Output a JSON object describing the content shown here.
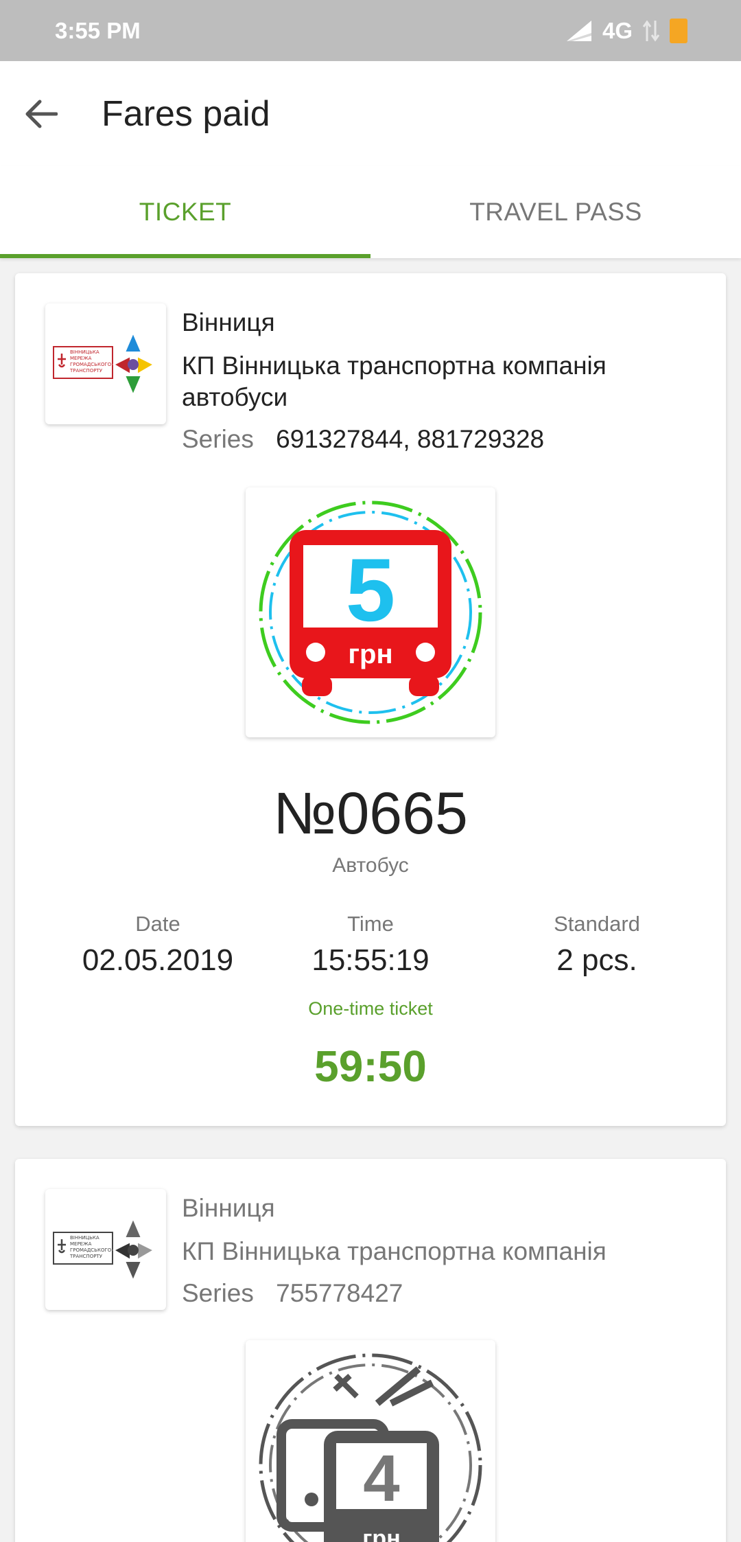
{
  "status_bar": {
    "time": "3:55 PM",
    "network": "4G"
  },
  "header": {
    "title": "Fares paid"
  },
  "tabs": [
    {
      "label": "TICKET",
      "active": true
    },
    {
      "label": "TRAVEL PASS",
      "active": false
    }
  ],
  "tickets": [
    {
      "city": "Вінниця",
      "company": "КП Вінницька транспортна компанія автобуси",
      "series_label": "Series",
      "series": "691327844, 881729328",
      "logo_text": [
        "ВІННИЦЬКА",
        "МЕРЕЖА",
        "ГРОМАДСЬКОГО",
        "ТРАНСПОРТУ"
      ],
      "fare_value": "5",
      "fare_currency": "грн",
      "number": "№0665",
      "transport": "Автобус",
      "date_label": "Date",
      "date": "02.05.2019",
      "time_label": "Time",
      "time": "15:55:19",
      "standard_label": "Standard",
      "standard": "2 pcs.",
      "type": "One-time ticket",
      "countdown": "59:50"
    },
    {
      "city": "Вінниця",
      "company": "КП Вінницька транспортна компанія",
      "series_label": "Series",
      "series": "755778427",
      "logo_text": [
        "ВІННИЦЬКА",
        "МЕРЕЖА",
        "ГРОМАДСЬКОГО",
        "ТРАНСПОРТУ"
      ],
      "fare_value": "4",
      "fare_currency": "грн"
    }
  ],
  "colors": {
    "accent": "#5aa02c",
    "bus_red": "#e8161b",
    "fare_blue": "#1ec0ee",
    "ring_green": "#3ecc1f",
    "inactive_gray": "#777777"
  }
}
